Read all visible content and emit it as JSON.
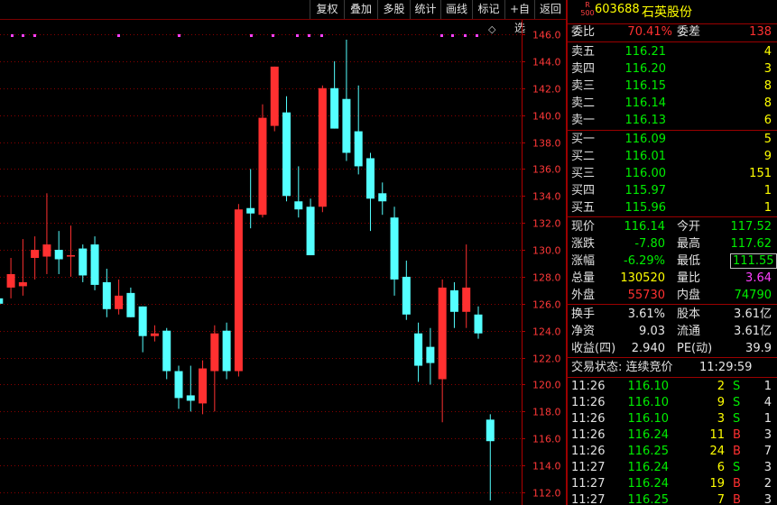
{
  "toolbar": {
    "buttons": [
      "复权",
      "叠加",
      "多股",
      "统计",
      "画线",
      "标记",
      "+自选",
      "返回"
    ]
  },
  "chart": {
    "y_labels": [
      "146.0",
      "144.0",
      "142.0",
      "140.0",
      "138.0",
      "136.0",
      "134.0",
      "132.0",
      "130.0",
      "128.0",
      "126.0",
      "124.0",
      "122.0",
      "120.0",
      "118.0",
      "116.0",
      "114.0",
      "112.0"
    ],
    "marker_symbol": "◇"
  },
  "chart_data": {
    "type": "candlestick",
    "ylim": [
      111.0,
      147.0
    ],
    "up_color": "#ff3030",
    "down_color": "#54ffff",
    "candles": [
      {
        "o": 126.4,
        "c": 126.0,
        "h": 127.2,
        "l": 124.4
      },
      {
        "o": 127.2,
        "c": 128.2,
        "h": 129.4,
        "l": 126.4
      },
      {
        "o": 127.3,
        "c": 127.6,
        "h": 130.8,
        "l": 126.6
      },
      {
        "o": 129.4,
        "c": 130.0,
        "h": 131.0,
        "l": 127.8
      },
      {
        "o": 129.5,
        "c": 130.4,
        "h": 134.2,
        "l": 128.2
      },
      {
        "o": 130.0,
        "c": 129.3,
        "h": 131.4,
        "l": 128.2
      },
      {
        "o": 129.5,
        "c": 129.6,
        "h": 131.8,
        "l": 128.0
      },
      {
        "o": 130.1,
        "c": 128.1,
        "h": 130.4,
        "l": 127.6
      },
      {
        "o": 130.4,
        "c": 127.4,
        "h": 131.0,
        "l": 127.0
      },
      {
        "o": 127.6,
        "c": 125.6,
        "h": 128.6,
        "l": 125.0
      },
      {
        "o": 125.6,
        "c": 126.6,
        "h": 127.8,
        "l": 125.2
      },
      {
        "o": 126.8,
        "c": 125.0,
        "h": 127.2,
        "l": 125.0
      },
      {
        "o": 125.8,
        "c": 123.6,
        "h": 125.8,
        "l": 122.4
      },
      {
        "o": 123.6,
        "c": 123.8,
        "h": 124.4,
        "l": 123.2
      },
      {
        "o": 124.0,
        "c": 121.0,
        "h": 124.2,
        "l": 120.4
      },
      {
        "o": 121.0,
        "c": 119.0,
        "h": 121.4,
        "l": 118.2
      },
      {
        "o": 119.2,
        "c": 118.8,
        "h": 121.4,
        "l": 118.0
      },
      {
        "o": 118.6,
        "c": 121.2,
        "h": 121.8,
        "l": 117.8
      },
      {
        "o": 121.0,
        "c": 123.8,
        "h": 124.4,
        "l": 118.0
      },
      {
        "o": 124.0,
        "c": 121.0,
        "h": 124.6,
        "l": 120.4
      },
      {
        "o": 121.0,
        "c": 133.0,
        "h": 133.4,
        "l": 120.6
      },
      {
        "o": 133.1,
        "c": 132.7,
        "h": 136.0,
        "l": 131.6
      },
      {
        "o": 132.6,
        "c": 139.8,
        "h": 140.8,
        "l": 132.4
      },
      {
        "o": 139.2,
        "c": 143.6,
        "h": 143.6,
        "l": 138.8
      },
      {
        "o": 140.2,
        "c": 134.0,
        "h": 141.4,
        "l": 133.6
      },
      {
        "o": 133.6,
        "c": 133.0,
        "h": 136.2,
        "l": 132.4
      },
      {
        "o": 133.2,
        "c": 129.6,
        "h": 133.8,
        "l": 129.6
      },
      {
        "o": 133.2,
        "c": 142.0,
        "h": 142.2,
        "l": 132.8
      },
      {
        "o": 142.0,
        "c": 139.0,
        "h": 144.0,
        "l": 139.0
      },
      {
        "o": 141.2,
        "c": 137.2,
        "h": 145.6,
        "l": 136.6
      },
      {
        "o": 138.8,
        "c": 136.2,
        "h": 142.2,
        "l": 135.6
      },
      {
        "o": 136.8,
        "c": 133.8,
        "h": 137.2,
        "l": 131.4
      },
      {
        "o": 134.2,
        "c": 133.6,
        "h": 135.0,
        "l": 132.6
      },
      {
        "o": 132.4,
        "c": 127.8,
        "h": 133.2,
        "l": 126.6
      },
      {
        "o": 128.0,
        "c": 125.2,
        "h": 129.2,
        "l": 124.8
      },
      {
        "o": 123.8,
        "c": 121.4,
        "h": 124.6,
        "l": 120.2
      },
      {
        "o": 122.8,
        "c": 121.6,
        "h": 124.2,
        "l": 120.0
      },
      {
        "o": 120.4,
        "c": 127.2,
        "h": 127.8,
        "l": 117.2
      },
      {
        "o": 127.0,
        "c": 125.4,
        "h": 127.6,
        "l": 124.2
      },
      {
        "o": 125.4,
        "c": 127.2,
        "h": 130.4,
        "l": 124.2
      },
      {
        "o": 125.2,
        "c": 123.8,
        "h": 125.8,
        "l": 123.4
      },
      {
        "o": 117.4,
        "c": 115.8,
        "h": 117.8,
        "l": 111.4
      }
    ]
  },
  "stock": {
    "badge_top": "R",
    "badge_bottom": "500",
    "code": "603688",
    "name": "石英股份"
  },
  "weibi": {
    "label1": "委比",
    "val1": "70.41%",
    "label2": "委差",
    "val2": "138"
  },
  "asks": [
    {
      "label": "卖五",
      "price": "116.21",
      "vol": "4"
    },
    {
      "label": "卖四",
      "price": "116.20",
      "vol": "3"
    },
    {
      "label": "卖三",
      "price": "116.15",
      "vol": "8"
    },
    {
      "label": "卖二",
      "price": "116.14",
      "vol": "8"
    },
    {
      "label": "卖一",
      "price": "116.13",
      "vol": "6"
    }
  ],
  "bids": [
    {
      "label": "买一",
      "price": "116.09",
      "vol": "5"
    },
    {
      "label": "买二",
      "price": "116.01",
      "vol": "9"
    },
    {
      "label": "买三",
      "price": "116.00",
      "vol": "151"
    },
    {
      "label": "买四",
      "price": "115.97",
      "vol": "1"
    },
    {
      "label": "买五",
      "price": "115.96",
      "vol": "1"
    }
  ],
  "quote": [
    {
      "l1": "现价",
      "v1": "116.14",
      "c1": "green",
      "l2": "今开",
      "v2": "117.52",
      "c2": "green",
      "boxed": false
    },
    {
      "l1": "涨跌",
      "v1": "-7.80",
      "c1": "green",
      "l2": "最高",
      "v2": "117.62",
      "c2": "green",
      "boxed": false
    },
    {
      "l1": "涨幅",
      "v1": "-6.29%",
      "c1": "green",
      "l2": "最低",
      "v2": "111.55",
      "c2": "green",
      "boxed": true
    },
    {
      "l1": "总量",
      "v1": "130520",
      "c1": "yellow",
      "l2": "量比",
      "v2": "3.64",
      "c2": "magenta",
      "boxed": false
    },
    {
      "l1": "外盘",
      "v1": "55730",
      "c1": "red",
      "l2": "内盘",
      "v2": "74790",
      "c2": "green",
      "boxed": false
    }
  ],
  "fundamentals": [
    {
      "l1": "换手",
      "v1": "3.61%",
      "l2": "股本",
      "v2": "3.61亿"
    },
    {
      "l1": "净资",
      "v1": "9.03",
      "l2": "流通",
      "v2": "3.61亿"
    },
    {
      "l1": "收益(四)",
      "v1": "2.940",
      "l2": "PE(动)",
      "v2": "39.9"
    }
  ],
  "status": {
    "label": "交易状态: 连续竞价",
    "time": "11:29:59"
  },
  "ticks": [
    {
      "time": "11:26",
      "price": "116.10",
      "vol": "2",
      "side": "S",
      "n": "1"
    },
    {
      "time": "11:26",
      "price": "116.10",
      "vol": "9",
      "side": "S",
      "n": "4"
    },
    {
      "time": "11:26",
      "price": "116.10",
      "vol": "3",
      "side": "S",
      "n": "1"
    },
    {
      "time": "11:26",
      "price": "116.24",
      "vol": "11",
      "side": "B",
      "n": "3"
    },
    {
      "time": "11:26",
      "price": "116.25",
      "vol": "24",
      "side": "B",
      "n": "7"
    },
    {
      "time": "11:27",
      "price": "116.24",
      "vol": "6",
      "side": "S",
      "n": "3"
    },
    {
      "time": "11:27",
      "price": "116.24",
      "vol": "19",
      "side": "B",
      "n": "2"
    },
    {
      "time": "11:27",
      "price": "116.25",
      "vol": "7",
      "side": "B",
      "n": "3"
    }
  ]
}
